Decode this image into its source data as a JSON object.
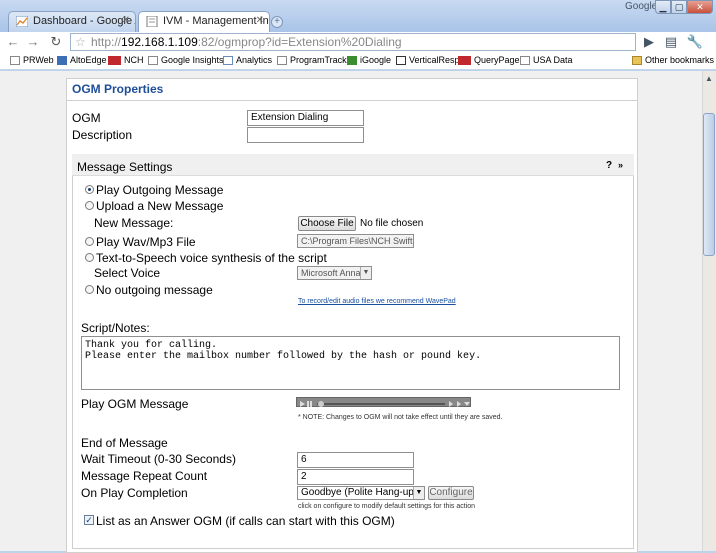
{
  "browser": {
    "tabs": [
      {
        "label": "Dashboard - Google Anal..."
      },
      {
        "label": "IVM - Management Interf..."
      }
    ],
    "brand": "Google",
    "url": {
      "prefix": "http://",
      "host": "192.168.1.109",
      "rest": ":82/ogmprop?id=Extension%20Dialing"
    },
    "bookmarks": [
      "PRWeb",
      "AltoEdge",
      "NCH",
      "Google Insights",
      "Analytics",
      "ProgramTrack",
      "iGoogle",
      "VerticalResp",
      "QueryPage",
      "USA Data",
      "Other bookmarks"
    ]
  },
  "panel": {
    "title": "OGM Properties",
    "ogm_label": "OGM",
    "ogm_value": "Extension Dialing",
    "description_label": "Description",
    "description_value": ""
  },
  "message_settings": {
    "title": "Message Settings",
    "help": "?",
    "collapse": "»",
    "options": [
      "Play Outgoing Message",
      "Upload a New Message",
      "Play Wav/Mp3 File",
      "Text-to-Speech voice synthesis of the script",
      "No outgoing message"
    ],
    "selected_option": 0,
    "new_message_label": "New Message:",
    "choose_file_label": "Choose File",
    "no_file_text": "No file chosen",
    "wav_path": "C:\\Program Files\\NCH Swift S",
    "select_voice_label": "Select Voice",
    "voice_value": "Microsoft Anna",
    "wavepad_note": "To record/edit audio files we recommend WavePad",
    "script_label": "Script/Notes:",
    "script_text": "Thank you for calling.\nPlease enter the mailbox number followed by the hash or pound key.",
    "play_label": "Play OGM Message",
    "player_note": "* NOTE: Changes to OGM will not take effect until they are saved.",
    "end_label": "End of Message",
    "wait_timeout_label": "Wait Timeout (0-30 Seconds)",
    "wait_timeout_value": "6",
    "repeat_label": "Message Repeat Count",
    "repeat_value": "2",
    "completion_label": "On Play Completion",
    "completion_value": "Goodbye (Polite Hang-up)",
    "configure_label": "Configure",
    "configure_note": "click on configure to modify default settings for this action",
    "answer_ogm_label": "List as an Answer OGM (if calls can start with this OGM)",
    "answer_ogm_checked": true
  },
  "colors": {
    "accent": "#1f4e99",
    "panel_bg": "#ffffff",
    "page_bg": "#f0f0f0"
  }
}
